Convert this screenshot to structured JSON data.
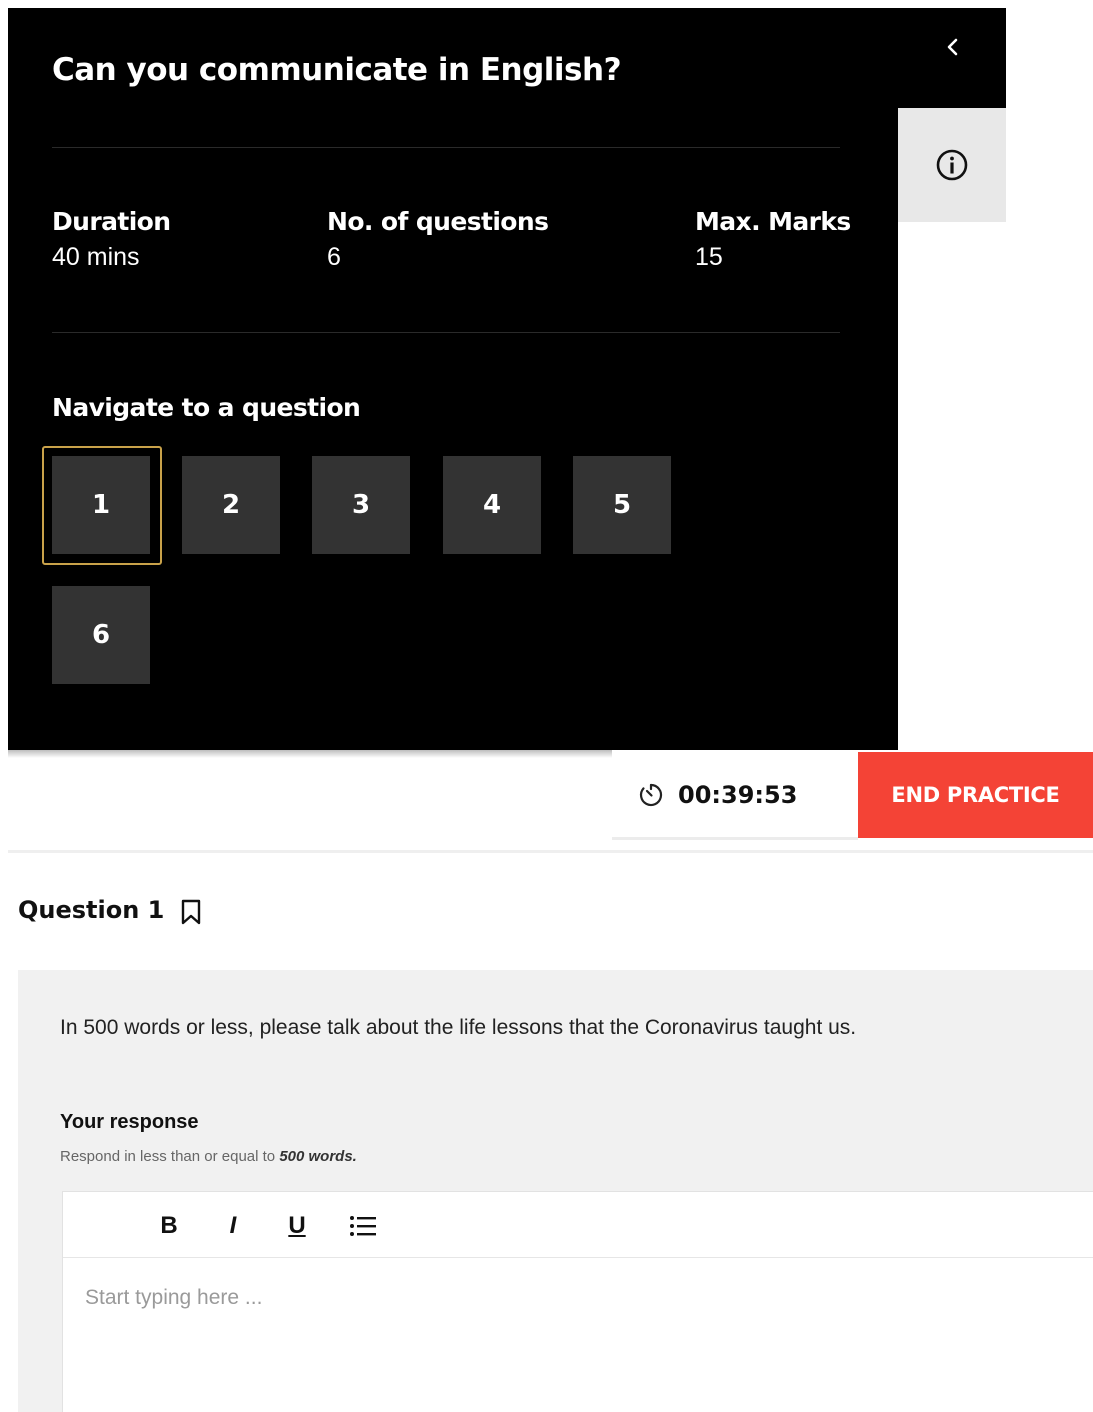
{
  "drawer": {
    "title": "Can you communicate in English?",
    "stats": [
      {
        "label": "Duration",
        "value": "40 mins"
      },
      {
        "label": "No. of questions",
        "value": "6"
      },
      {
        "label": "Max. Marks",
        "value": "15"
      }
    ],
    "navigate_heading": "Navigate to a question",
    "questions": [
      "1",
      "2",
      "3",
      "4",
      "5",
      "6"
    ],
    "active_question": "1",
    "colors": {
      "background": "#000000",
      "tile": "#333333",
      "active_ring": "#c9a24a"
    }
  },
  "toolbar": {
    "timer": "00:39:53",
    "end_button": "END PRACTICE",
    "end_button_color": "#f44336",
    "icons": {
      "back": "chevron-left-icon",
      "info": "info-circle-icon",
      "timer": "timer-icon"
    }
  },
  "question": {
    "title": "Question 1",
    "bookmark_icon": "bookmark-icon",
    "prompt": "In 500 words or less, please talk about the life lessons that the Coronavirus taught us.",
    "response_label": "Your response",
    "response_hint_prefix": "Respond in less than or equal to ",
    "response_hint_limit": "500 words.",
    "editor": {
      "bold": "B",
      "italic": "I",
      "underline": "U",
      "list_icon": "bulleted-list-icon",
      "placeholder": "Start typing here ..."
    }
  }
}
